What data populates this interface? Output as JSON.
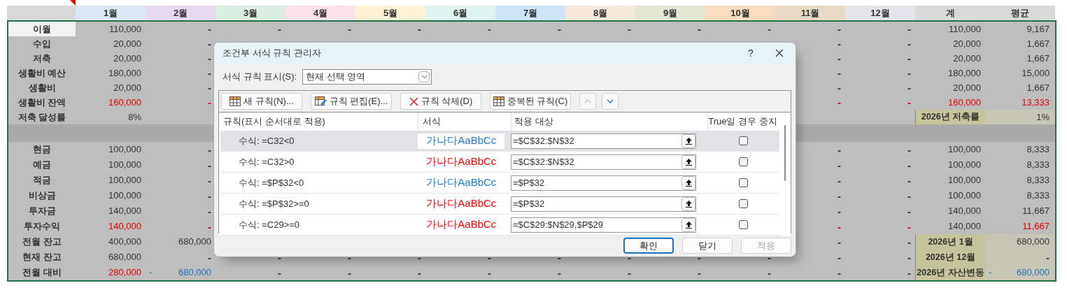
{
  "columns": [
    {
      "label": "1월",
      "color": "#dce7f4"
    },
    {
      "label": "2월",
      "color": "#e7d9f0"
    },
    {
      "label": "3월",
      "color": "#dbefe1"
    },
    {
      "label": "4월",
      "color": "#fbe1ea"
    },
    {
      "label": "5월",
      "color": "#fdf1d8"
    },
    {
      "label": "6월",
      "color": "#dff3ef"
    },
    {
      "label": "7월",
      "color": "#cde5f6"
    },
    {
      "label": "8월",
      "color": "#f5e7da"
    },
    {
      "label": "9월",
      "color": "#e3e6d2"
    },
    {
      "label": "10월",
      "color": "#f7dcbf"
    },
    {
      "label": "11월",
      "color": "#e7d9c6"
    },
    {
      "label": "12월",
      "color": "#e3e3e9"
    },
    {
      "label": "계",
      "color": "#d9d9d9"
    },
    {
      "label": "평균",
      "color": "#d9d9d9"
    }
  ],
  "rows": [
    {
      "kind": "data",
      "label": "이월",
      "selected": true,
      "months": [
        {
          "text": "110,000"
        },
        {
          "text": "-"
        },
        {
          "text": "-"
        },
        {
          "text": "-"
        },
        {
          "text": "-"
        },
        {
          "text": "-"
        },
        {
          "text": "-"
        },
        {
          "text": "-"
        },
        {
          "text": "-"
        },
        {
          "text": "-"
        },
        {
          "text": "-"
        },
        {
          "text": "-"
        }
      ],
      "total": {
        "text": "110,000"
      },
      "average": {
        "text": "9,167"
      }
    },
    {
      "kind": "data",
      "label": "수입",
      "selected": false,
      "months": [
        {
          "text": "20,000"
        },
        {
          "text": "-"
        }
      ],
      "months_end": [
        {
          "text": "-"
        },
        {
          "text": "-"
        }
      ],
      "total": {
        "text": "20,000"
      },
      "average": {
        "text": "1,667"
      }
    },
    {
      "kind": "data",
      "label": "저축",
      "selected": false,
      "months": [
        {
          "text": "20,000"
        },
        {
          "text": "-"
        }
      ],
      "months_end": [
        {
          "text": "-"
        },
        {
          "text": "-"
        }
      ],
      "total": {
        "text": "20,000"
      },
      "average": {
        "text": "1,667"
      }
    },
    {
      "kind": "data",
      "label": "생활비 예산",
      "selected": false,
      "months": [
        {
          "text": "180,000"
        },
        {
          "text": "-"
        }
      ],
      "months_end": [
        {
          "text": "-"
        },
        {
          "text": "-"
        }
      ],
      "total": {
        "text": "180,000"
      },
      "average": {
        "text": "15,000"
      }
    },
    {
      "kind": "data",
      "label": "생활비",
      "selected": false,
      "months": [
        {
          "text": "20,000"
        },
        {
          "text": "-"
        }
      ],
      "months_end": [
        {
          "text": "-"
        },
        {
          "text": "-"
        }
      ],
      "total": {
        "text": "20,000"
      },
      "average": {
        "text": "1,667"
      }
    },
    {
      "kind": "data",
      "label": "생활비 잔액",
      "selected": false,
      "months": [
        {
          "text": "160,000",
          "color": "#e00000"
        },
        {
          "text": "-",
          "color": "#e00000"
        }
      ],
      "months_end": [
        {
          "text": "-",
          "color": "#e00000"
        },
        {
          "text": "-",
          "color": "#e00000"
        }
      ],
      "total": {
        "text": "160,000",
        "color": "#e00000"
      },
      "average": {
        "text": "13,333",
        "color": "#e00000"
      }
    },
    {
      "kind": "data",
      "label": "저축 달성률",
      "selected": false,
      "months": [
        {
          "text": "8%"
        }
      ],
      "summary": {
        "label": "2026년 저축률",
        "value": {
          "text": "1%"
        }
      }
    },
    {
      "kind": "gap"
    },
    {
      "kind": "data",
      "label": "현금",
      "selected": false,
      "months": [
        {
          "text": "100,000"
        },
        {
          "text": "-"
        }
      ],
      "months_end": [
        {
          "text": "-"
        },
        {
          "text": "-"
        }
      ],
      "total": {
        "text": "100,000"
      },
      "average": {
        "text": "8,333"
      }
    },
    {
      "kind": "data",
      "label": "예금",
      "selected": false,
      "months": [
        {
          "text": "100,000"
        },
        {
          "text": "-"
        }
      ],
      "months_end": [
        {
          "text": "-"
        },
        {
          "text": "-"
        }
      ],
      "total": {
        "text": "100,000"
      },
      "average": {
        "text": "8,333"
      }
    },
    {
      "kind": "data",
      "label": "적금",
      "selected": false,
      "months": [
        {
          "text": "100,000"
        },
        {
          "text": "-"
        }
      ],
      "months_end": [
        {
          "text": "-"
        },
        {
          "text": "-"
        }
      ],
      "total": {
        "text": "100,000"
      },
      "average": {
        "text": "8,333"
      }
    },
    {
      "kind": "data",
      "label": "비상금",
      "selected": false,
      "months": [
        {
          "text": "100,000"
        },
        {
          "text": "-"
        }
      ],
      "months_end": [
        {
          "text": "-"
        },
        {
          "text": "-"
        }
      ],
      "total": {
        "text": "100,000"
      },
      "average": {
        "text": "8,333"
      }
    },
    {
      "kind": "data",
      "label": "투자금",
      "selected": false,
      "months": [
        {
          "text": "140,000"
        },
        {
          "text": "-"
        }
      ],
      "months_end": [
        {
          "text": "-"
        },
        {
          "text": "-"
        }
      ],
      "total": {
        "text": "140,000"
      },
      "average": {
        "text": "11,667"
      }
    },
    {
      "kind": "data",
      "label": "투자수익",
      "selected": false,
      "months": [
        {
          "text": "140,000",
          "color": "#e00000"
        },
        {
          "text": "-",
          "color": "#e00000"
        }
      ],
      "months_end": [
        {
          "text": "-",
          "color": "#e00000"
        },
        {
          "text": "-",
          "color": "#e00000"
        }
      ],
      "total": {
        "text": "140,000"
      },
      "average": {
        "text": "11,667",
        "color": "#e00000"
      }
    },
    {
      "kind": "data",
      "label": "전월 잔고",
      "selected": false,
      "months": [
        {
          "text": "400,000"
        },
        {
          "text": "680,000"
        }
      ],
      "months_end": [
        {
          "text": "-"
        },
        {
          "text": "-"
        }
      ],
      "summary": {
        "label": "2026년 1월",
        "value": {
          "text": "680,000"
        }
      }
    },
    {
      "kind": "data",
      "label": "현재 잔고",
      "selected": false,
      "months": [
        {
          "text": "680,000"
        },
        {
          "text": "-"
        },
        {
          "text": "-"
        },
        {
          "text": "-"
        },
        {
          "text": "-"
        },
        {
          "text": "-"
        },
        {
          "text": "-"
        },
        {
          "text": "-"
        },
        {
          "text": "-"
        },
        {
          "text": "-"
        },
        {
          "text": "-"
        },
        {
          "text": "-"
        }
      ],
      "summary": {
        "label": "2026년 12월",
        "value": {
          "text": "-"
        }
      }
    },
    {
      "kind": "data",
      "label": "전월 대비",
      "selected": false,
      "months": [
        {
          "text": "280,000",
          "color": "#e00000"
        },
        {
          "text": "680,000",
          "sign": "-",
          "color": "#1f6fb8"
        },
        {
          "text": "-"
        },
        {
          "text": "-"
        },
        {
          "text": "-"
        },
        {
          "text": "-"
        },
        {
          "text": "-"
        },
        {
          "text": "-"
        },
        {
          "text": "-"
        },
        {
          "text": "-"
        },
        {
          "text": "-"
        },
        {
          "text": "-"
        }
      ],
      "summary": {
        "label": "2026년 자산변동",
        "value": {
          "text": "680,000",
          "sign": "-",
          "color": "#1f6fb8"
        }
      }
    }
  ],
  "dialog": {
    "title": "조건부 서식 규칙 관리자",
    "help": "?",
    "show_label": "서식 규칙 표시(S):",
    "show_value": "현재 선택 영역",
    "toolbar": [
      {
        "kind": "new",
        "label": "새 규칙(N)..."
      },
      {
        "kind": "edit",
        "label": "규칙 편집(E)..."
      },
      {
        "kind": "delete",
        "label": "규칙 삭제(D)"
      },
      {
        "kind": "duplicate",
        "label": "중복된 규칙(C)"
      }
    ],
    "move_up": {
      "disabled": true
    },
    "move_down": {
      "disabled": false
    },
    "headers": [
      "규칙(표시 순서대로 적용)",
      "서식",
      "적용 대상",
      "True일 경우 중지"
    ],
    "rules": [
      {
        "condition": "수식: =C32<0",
        "preview": "가나다AaBbCc",
        "color": "#1e7ac8",
        "applies_to": "=$C$32:$N$32",
        "stop_if_true": false,
        "selected": true
      },
      {
        "condition": "수식: =C32>0",
        "preview": "가나다AaBbCc",
        "color": "#ff0000",
        "applies_to": "=$C$32:$N$32",
        "stop_if_true": false,
        "selected": false
      },
      {
        "condition": "수식: =$P$32<0",
        "preview": "가나다AaBbCc",
        "color": "#1e7ac8",
        "applies_to": "=$P$32",
        "stop_if_true": false,
        "selected": false
      },
      {
        "condition": "수식: =$P$32>=0",
        "preview": "가나다AaBbCc",
        "color": "#ff0000",
        "applies_to": "=$P$32",
        "stop_if_true": false,
        "selected": false
      },
      {
        "condition": "수식: =C29>=0",
        "preview": "가나다AaBbCc",
        "color": "#ff0000",
        "applies_to": "=$C$29:$N$29,$P$29",
        "stop_if_true": false,
        "selected": false
      }
    ],
    "buttons": [
      {
        "label": "확인",
        "kind": "primary",
        "disabled": false
      },
      {
        "label": "닫기",
        "kind": "normal",
        "disabled": false
      },
      {
        "label": "적용",
        "kind": "normal",
        "disabled": true
      }
    ]
  }
}
